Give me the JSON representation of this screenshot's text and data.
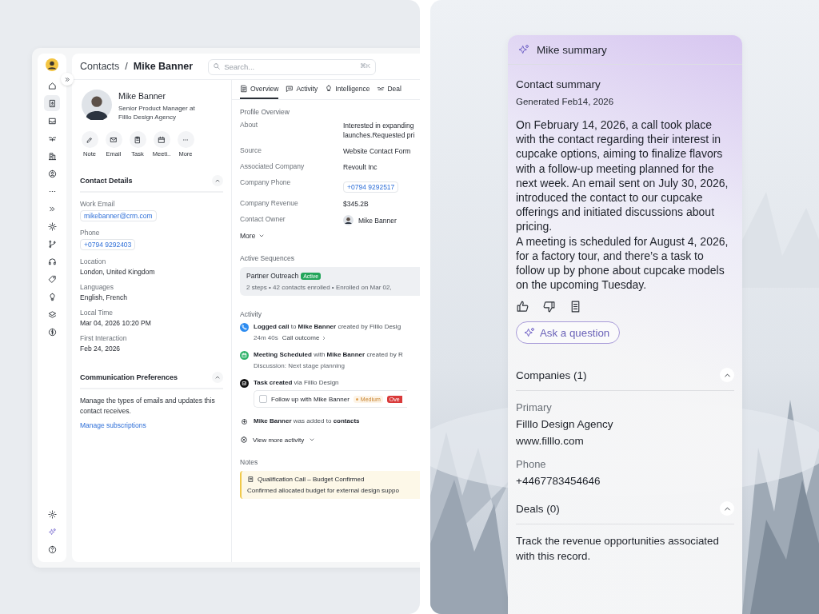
{
  "crm_window": {
    "breadcrumb": {
      "parent": "Contacts",
      "separator": "/",
      "current": "Mike Banner"
    },
    "search": {
      "placeholder": "Search...",
      "shortcut": "⌘K"
    },
    "nav_top": [
      {
        "selected": false
      },
      {
        "selected": true
      },
      {
        "selected": false
      },
      {
        "selected": false
      },
      {
        "selected": false
      },
      {
        "selected": false
      },
      {
        "selected": false
      },
      {
        "selected": false
      },
      {
        "selected": false
      },
      {
        "selected": false
      },
      {
        "selected": false
      },
      {
        "selected": false
      },
      {
        "selected": false
      },
      {
        "selected": false
      },
      {
        "selected": false
      }
    ],
    "nav_bottom": [
      {
        "selected": false
      },
      {
        "selected": false
      },
      {
        "selected": false
      }
    ],
    "profile": {
      "name": "Mike Banner",
      "title": "Senior Product Manager at Filllo Design Agency",
      "actions": [
        "Note",
        "Email",
        "Task",
        "Meeti..",
        "More"
      ]
    },
    "contact_details": {
      "title": "Contact Details",
      "expanded": true,
      "fields": [
        {
          "label": "Work Email",
          "value": "mikebanner@crm.com",
          "kind": "chip"
        },
        {
          "label": "Phone",
          "value": "+0794 9292403",
          "kind": "chip"
        },
        {
          "label": "Location",
          "value": "London, United Kingdom",
          "kind": "text"
        },
        {
          "label": "Languages",
          "value": "English, French",
          "kind": "text"
        },
        {
          "label": "Local Time",
          "value": "Mar 04, 2026 10:20 PM",
          "kind": "text"
        },
        {
          "label": "First Interaction",
          "value": "Feb 24, 2026",
          "kind": "text"
        }
      ]
    },
    "communication": {
      "title": "Communication Preferences",
      "expanded": true,
      "text": "Manage the types of emails and updates this contact receives.",
      "link": "Manage subscriptions"
    },
    "tabs": [
      {
        "label": "Overview",
        "selected": true
      },
      {
        "label": "Activity",
        "selected": false
      },
      {
        "label": "Intelligence",
        "selected": false
      },
      {
        "label": "Deal",
        "selected": false
      }
    ],
    "profile_overview": {
      "title": "Profile Overview",
      "rows": [
        {
          "label": "About",
          "kind": "lines",
          "lines": [
            "Interested in expanding",
            "launches.Requested pri"
          ]
        },
        {
          "label": "Source",
          "kind": "text",
          "value": "Website Contact Form"
        },
        {
          "label": "Associated Company",
          "kind": "text",
          "value": "Revoult Inc"
        },
        {
          "label": "Company Phone",
          "kind": "chip",
          "value": "+0794 9292517"
        },
        {
          "label": "Company Revenue",
          "kind": "text",
          "value": "$345.2B"
        },
        {
          "label": "Contact Owner",
          "kind": "person",
          "value": "Mike Banner"
        }
      ],
      "more": "More"
    },
    "active_sequences": {
      "title": "Active Sequences",
      "items": [
        {
          "name": "Partner Outreach",
          "status": "Active",
          "details": "2 steps • 42 contacts enrolled • Enrolled on Mar 02,"
        }
      ]
    },
    "activity": {
      "title": "Activity",
      "items": [
        {
          "kind": "call",
          "text": "**Logged call** to **Mike Banner** created by Filllo Desig",
          "sub": "24m 40s",
          "link": "Call outcome"
        },
        {
          "kind": "meeting",
          "text": "**Meeting Scheduled** with **Mike Banner** created by R",
          "sub": "Discussion: Next stage planning"
        },
        {
          "kind": "task",
          "text": "**Task created** via Filllo Design",
          "task": {
            "label": "Follow up with Mike Banner",
            "checked": false,
            "priority": "Medium",
            "status": "Ove"
          }
        },
        {
          "kind": "added",
          "text": "**Mike Banner** was added to **contacts**"
        }
      ],
      "more": "View more activity"
    },
    "notes": {
      "title": "Notes",
      "items": [
        {
          "title": "Qualification Call – Budget Confirmed",
          "text": "Confirmed allocated budget for external design suppo"
        }
      ]
    }
  },
  "summary_panel": {
    "title": "Mike summary",
    "heading": "Contact summary",
    "generated": "Generated Feb14, 2026",
    "paragraphs": [
      "On February 14, 2026, a call took place with the contact regarding their interest in cupcake options, aiming to finalize flavors with a follow-up meeting planned for the next week. An email sent on July 30, 2026, introduced the contact to our cupcake offerings and initiated discussions about pricing.",
      "A meeting is scheduled for August 4, 2026, for a factory tour, and there’s a task to follow up by phone about cupcake models on the upcoming Tuesday."
    ],
    "ask": "Ask a question",
    "companies": {
      "title": "Companies (1)",
      "expanded": true,
      "primary_label": "Primary",
      "name": "Filllo Design Agency",
      "website": "www.filllo.com",
      "phone_label": "Phone",
      "phone": "+4467783454646"
    },
    "deals": {
      "title": "Deals (0)",
      "expanded": true,
      "text": "Track the revenue opportunities associated with this record."
    }
  }
}
